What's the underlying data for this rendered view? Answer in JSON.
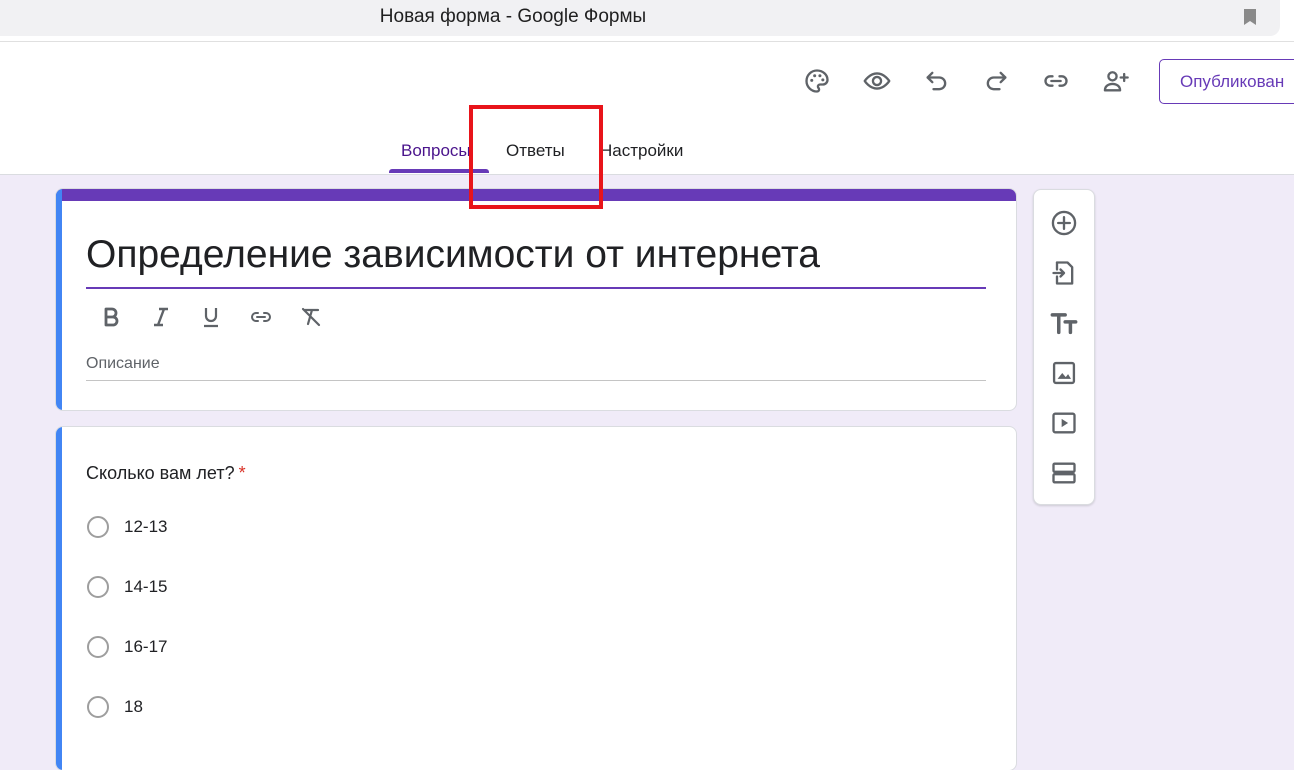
{
  "browser": {
    "window_title": "Новая форма - Google Формы",
    "bookmark_icon": "bookmark-icon"
  },
  "header": {
    "icons": [
      "palette-icon",
      "eye-icon",
      "undo-icon",
      "redo-icon",
      "link-icon",
      "add-person-icon"
    ],
    "publish_label": "Опубликован"
  },
  "tabs": [
    {
      "label": "Вопросы",
      "active": true
    },
    {
      "label": "Ответы",
      "active": false
    },
    {
      "label": "Настройки",
      "active": false
    }
  ],
  "form": {
    "title": "Определение зависимости от интернета",
    "format_icons": [
      "bold-icon",
      "italic-icon",
      "underline-icon",
      "link-icon",
      "clear-format-icon"
    ],
    "description_placeholder": "Описание"
  },
  "question": {
    "text": "Сколько вам лет?",
    "required_mark": "*",
    "options": [
      "12-13",
      "14-15",
      "16-17",
      "18"
    ]
  },
  "side_toolbar": {
    "icons": [
      "add-question-icon",
      "import-questions-icon",
      "add-title-icon",
      "add-image-icon",
      "add-video-icon",
      "add-section-icon"
    ]
  },
  "colors": {
    "accent": "#673ab7",
    "left_bar": "#4285f4",
    "background": "#f0ebf8",
    "annotation": "#e8141a"
  }
}
